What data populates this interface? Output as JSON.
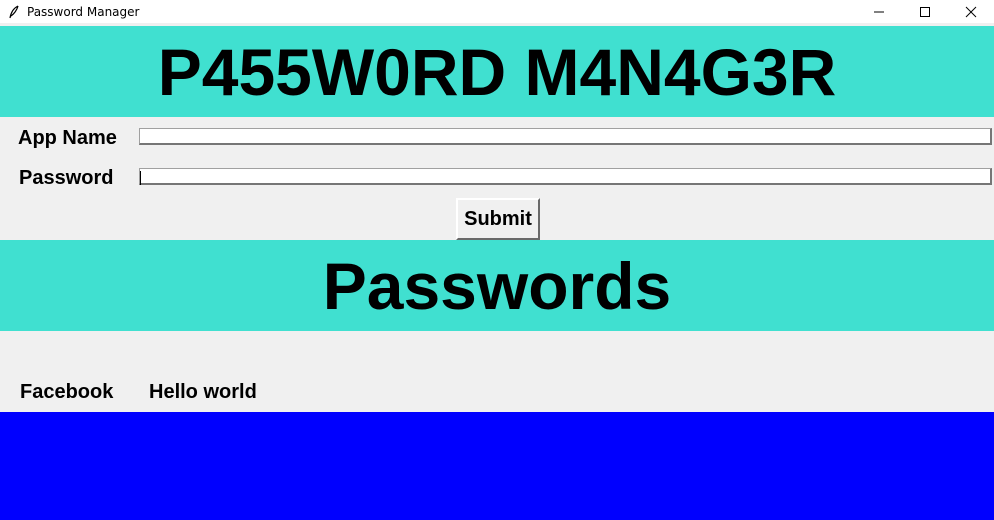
{
  "window": {
    "title": "Password Manager",
    "icon": "feather-icon",
    "controls": [
      "minimize-icon",
      "maximize-icon",
      "close-icon"
    ]
  },
  "header": {
    "title": "P455W0RD M4N4G3R",
    "color": "#40e0d0"
  },
  "form": {
    "app_name_label": "App Name",
    "app_name_value": "",
    "password_label": "Password",
    "password_value": "",
    "submit_label": "Submit"
  },
  "passwords_section": {
    "title": "Passwords",
    "color": "#40e0d0",
    "entries": [
      {
        "app": "Facebook",
        "password": "Hello world"
      }
    ]
  },
  "footer": {
    "color": "#0000ff"
  }
}
